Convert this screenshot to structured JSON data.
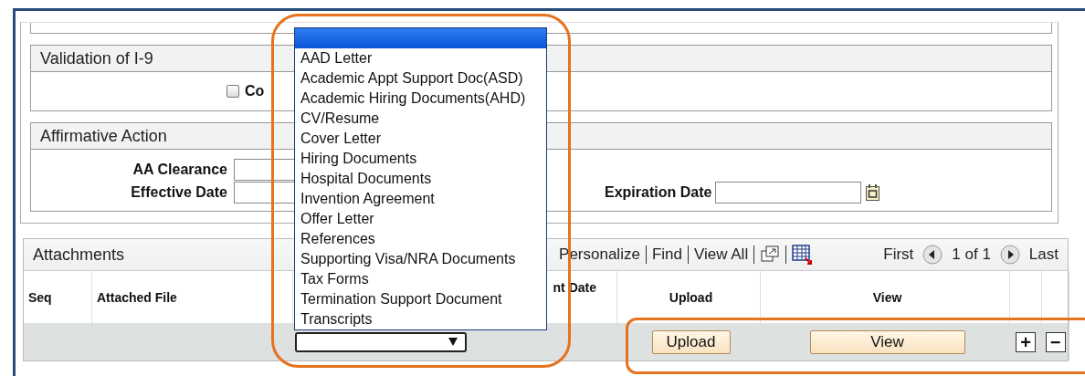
{
  "validation_section": {
    "title": "Validation of I-9",
    "checkbox": {
      "label": "Co",
      "checked": false
    }
  },
  "affirmative_action": {
    "title": "Affirmative Action",
    "fields": [
      {
        "label": "AA Clearance"
      },
      {
        "label": "Effective Date"
      },
      {
        "label": "Expiration Date"
      }
    ]
  },
  "attachments": {
    "title": "Attachments",
    "toolbar_links": [
      "Personalize",
      "Find",
      "View All"
    ],
    "pager": {
      "first": "First",
      "range": "1 of 1",
      "last": "Last"
    },
    "columns": [
      "Seq",
      "Attached File",
      "nt Date",
      "Upload",
      "View"
    ],
    "rows": [
      {
        "upload_button": "Upload",
        "view_button": "View",
        "add_button": "+",
        "delete_button": "−"
      }
    ]
  },
  "dropdown": {
    "items": [
      {
        "selected": true
      },
      {
        "label": "AAD Letter",
        "selected": false
      },
      {
        "label": "Academic Appt Support Doc(ASD)",
        "selected": false
      },
      {
        "label": "Academic Hiring Documents(AHD)",
        "selected": false
      },
      {
        "label": "CV/Resume",
        "selected": false
      },
      {
        "label": "Cover Letter",
        "selected": false
      },
      {
        "label": "Hiring Documents",
        "selected": false
      },
      {
        "label": "Hospital Documents",
        "selected": false
      },
      {
        "label": "Invention Agreement",
        "selected": false
      },
      {
        "label": "Offer Letter",
        "selected": false
      },
      {
        "label": "References",
        "selected": false
      },
      {
        "label": "Supporting Visa/NRA Documents",
        "selected": false
      },
      {
        "label": "Tax Forms",
        "selected": false
      },
      {
        "label": "Termination Support Document",
        "selected": false
      },
      {
        "label": "Transcripts",
        "selected": false
      }
    ]
  },
  "annotations": [
    {
      "kind": "highlight"
    },
    {
      "kind": "highlight"
    }
  ]
}
